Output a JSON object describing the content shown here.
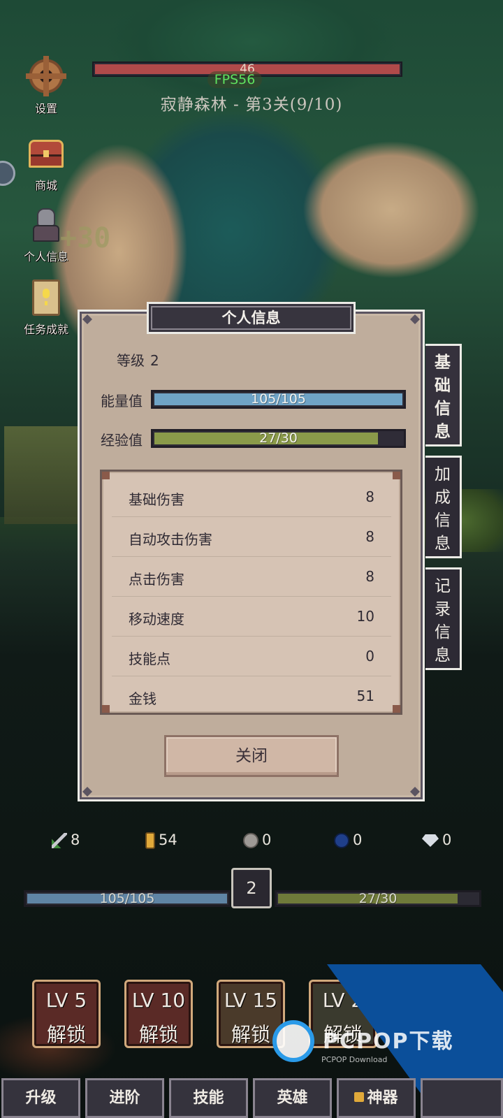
{
  "hud": {
    "hp_value": "46",
    "hp_fraction": 1.0,
    "fps": "FPS56",
    "stage_title": "寂静森林 - 第3关(9/10)",
    "ghost_text": "+30"
  },
  "side_menu": [
    {
      "label": "设置",
      "icon": "gear-icon"
    },
    {
      "label": "商城",
      "icon": "treasure-chest-icon"
    },
    {
      "label": "个人信息",
      "icon": "knight-avatar-icon"
    },
    {
      "label": "任务成就",
      "icon": "quest-scroll-icon"
    }
  ],
  "dialog": {
    "title": "个人信息",
    "level_label": "等级",
    "level_value": "2",
    "energy_label": "能量值",
    "energy_text": "105/105",
    "energy_fraction": 1.0,
    "exp_label": "经验值",
    "exp_text": "27/30",
    "exp_fraction": 0.9,
    "stats": [
      {
        "name": "基础伤害",
        "value": "8"
      },
      {
        "name": "自动攻击伤害",
        "value": "8"
      },
      {
        "name": "点击伤害",
        "value": "8"
      },
      {
        "name": "移动速度",
        "value": "10"
      },
      {
        "name": "技能点",
        "value": "0"
      },
      {
        "name": "金钱",
        "value": "51"
      }
    ],
    "close_label": "关闭",
    "tabs": [
      {
        "label": "基础信息",
        "active": true
      },
      {
        "label": "加成信息",
        "active": false
      },
      {
        "label": "记录信息",
        "active": false
      }
    ]
  },
  "resources": [
    {
      "icon": "sword-icon",
      "value": "8"
    },
    {
      "icon": "gold-bar-icon",
      "value": "54"
    },
    {
      "icon": "silver-coin-icon",
      "value": "0"
    },
    {
      "icon": "blue-orb-icon",
      "value": "0"
    },
    {
      "icon": "diamond-icon",
      "value": "0"
    }
  ],
  "player_bars": {
    "energy_text": "105/105",
    "energy_fraction": 1.0,
    "exp_text": "27/30",
    "exp_fraction": 0.9,
    "level": "2"
  },
  "skills": [
    {
      "line1": "LV 5",
      "line2": "解锁"
    },
    {
      "line1": "LV 10",
      "line2": "解锁"
    },
    {
      "line1": "LV 15",
      "line2": "解锁"
    },
    {
      "line1": "LV 2",
      "line2": "解锁"
    }
  ],
  "nav": [
    {
      "label": "升级"
    },
    {
      "label": "进阶"
    },
    {
      "label": "技能"
    },
    {
      "label": "英雄"
    },
    {
      "label": "神器",
      "locked": true
    }
  ],
  "watermark": {
    "brand": "PCPOP下载",
    "sub": "PCPOP Download"
  },
  "colors": {
    "energy": "#6fa3c6",
    "exp": "#8a9a4a",
    "hp": "#b04a4a",
    "panel": "#bfad9c"
  }
}
